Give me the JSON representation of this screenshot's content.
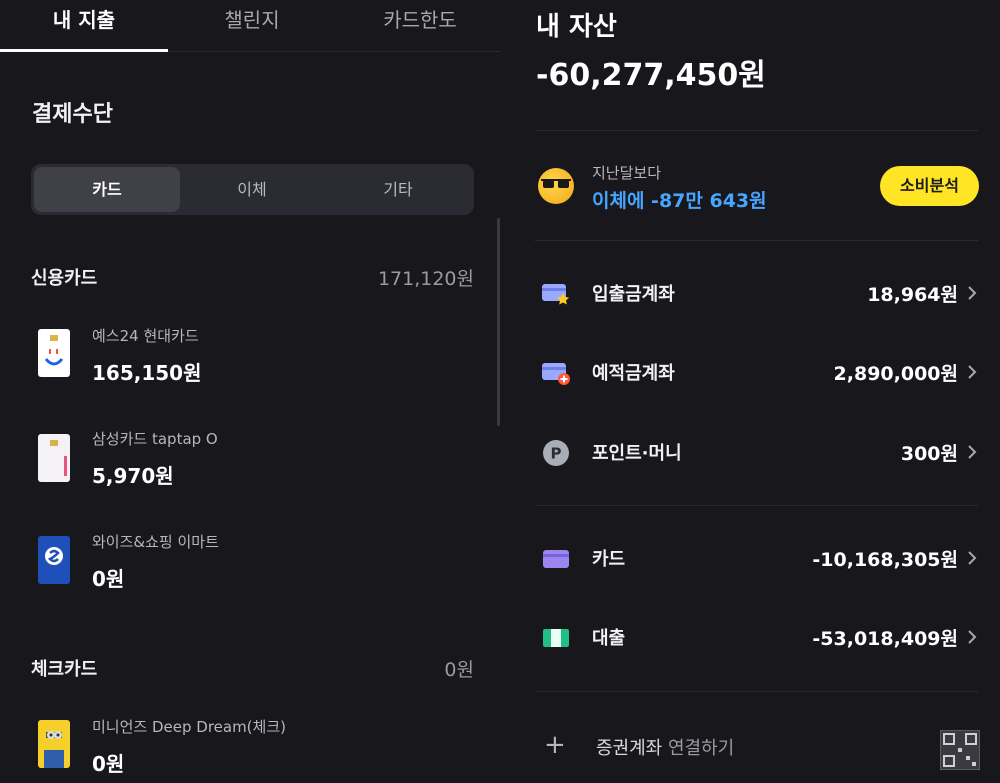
{
  "left": {
    "tabs": [
      {
        "label": "내 지출",
        "active": true
      },
      {
        "label": "챌린지",
        "active": false
      },
      {
        "label": "카드한도",
        "active": false
      }
    ],
    "section_title": "결제수단",
    "segments": [
      {
        "label": "카드",
        "active": true
      },
      {
        "label": "이체",
        "active": false
      },
      {
        "label": "기타",
        "active": false
      }
    ],
    "credit": {
      "title": "신용카드",
      "total": "171,120원",
      "cards": [
        {
          "name": "예스24 현대카드",
          "amount": "165,150원"
        },
        {
          "name": "삼성카드 taptap O",
          "amount": "5,970원"
        },
        {
          "name": "와이즈&쇼핑 이마트",
          "amount": "0원"
        }
      ]
    },
    "check": {
      "title": "체크카드",
      "total": "0원",
      "cards": [
        {
          "name": "미니언즈 Deep Dream(체크)",
          "amount": "0원"
        }
      ]
    }
  },
  "right": {
    "title": "내 자산",
    "total": "-60,277,450원",
    "compare_label": "지난달보다",
    "compare_value": "이체에 -87만 643원",
    "analysis_button": "소비분석",
    "accounts": [
      {
        "name": "입출금계좌",
        "value": "18,964원",
        "icon": "card-star-icon"
      },
      {
        "name": "예적금계좌",
        "value": "2,890,000원",
        "icon": "card-plus-icon"
      },
      {
        "name": "포인트·머니",
        "value": "300원",
        "icon": "point-icon"
      },
      {
        "name": "카드",
        "value": "-10,168,305원",
        "icon": "credit-card-icon"
      },
      {
        "name": "대출",
        "value": "-53,018,409원",
        "icon": "loan-icon"
      }
    ],
    "connect_strong": "증권계좌",
    "connect_rest": " 연결하기"
  },
  "colors": {
    "background": "#17171c",
    "accent_yellow": "#ffe523",
    "accent_blue": "#46a6ff"
  }
}
